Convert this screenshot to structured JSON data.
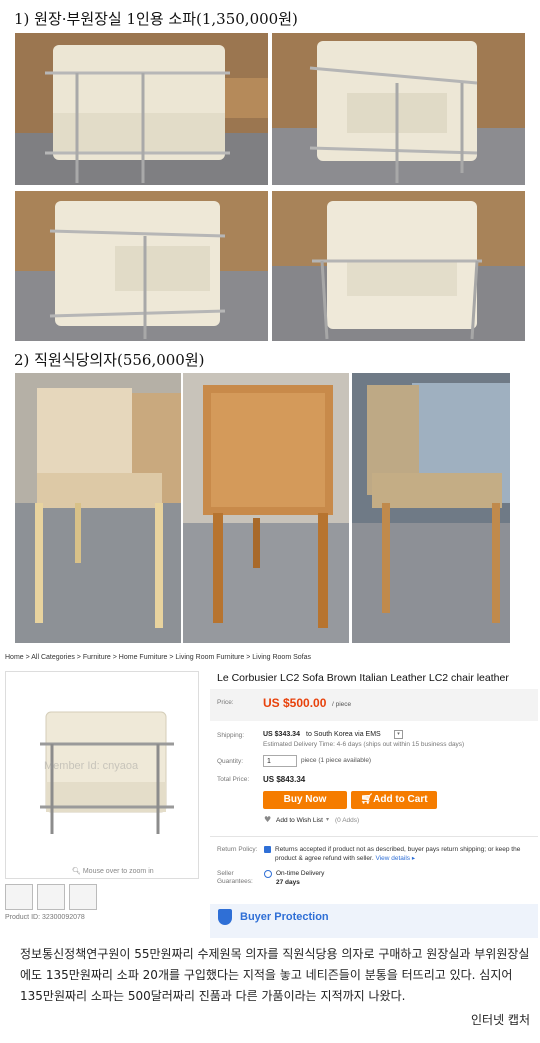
{
  "section1": {
    "heading": "1) 원장·부원장실 1인용 소파(1,350,000원)"
  },
  "section2": {
    "heading": "2) 직원식당의자(556,000원)"
  },
  "store": {
    "breadcrumb": "Home > All Categories > Furniture > Home Furniture > Living Room Furniture > Living Room Sofas",
    "watermark": "Member Id: cnyaoa",
    "zoom_hint": "Mouse over to zoom in",
    "product_id": "Product ID: 32300092078",
    "title": "Le Corbusier LC2 Sofa Brown Italian Leather LC2 chair leather",
    "price_label": "Price:",
    "price_value": "US $500.00",
    "price_unit": "/ piece",
    "shipping_label": "Shipping:",
    "shipping_value": "US $343.34",
    "shipping_to": "to South Korea via EMS",
    "delivery_time": "Estimated Delivery Time: 4-6 days (ships out within 15 business days)",
    "quantity_label": "Quantity:",
    "quantity_value": "1",
    "quantity_note": "piece (1 piece available)",
    "total_label": "Total Price:",
    "total_value": "US $843.34",
    "buy_now": "Buy Now",
    "add_to_cart": "Add to Cart",
    "wishlist": "Add to Wish List",
    "wishlist_count": "(0 Adds)",
    "return_label": "Return Policy:",
    "return_text": "Returns accepted if product not as described, buyer pays return shipping; or keep the product & agree refund with seller.",
    "view_details": "View details",
    "guarantee_label": "Seller Guarantees:",
    "ontime": "On-time Delivery",
    "ontime_days": "27 days",
    "buyer_protection": "Buyer Protection",
    "accent_color": "#f57c00",
    "price_color": "#e8420c"
  },
  "caption": {
    "text": "정보통신정책연구원이 55만원짜리 수제원목 의자를 직원식당용 의자로 구매하고 원장실과 부위원장실에도 135만원짜리 소파 20개를 구입했다는 지적을 놓고 네티즌들이 분통을 터뜨리고 있다. 심지어 135만원짜리 소파는 500달러짜리 진품과 다른 가품이라는 지적까지 나왔다.",
    "credit": "인터넷 캡처"
  }
}
